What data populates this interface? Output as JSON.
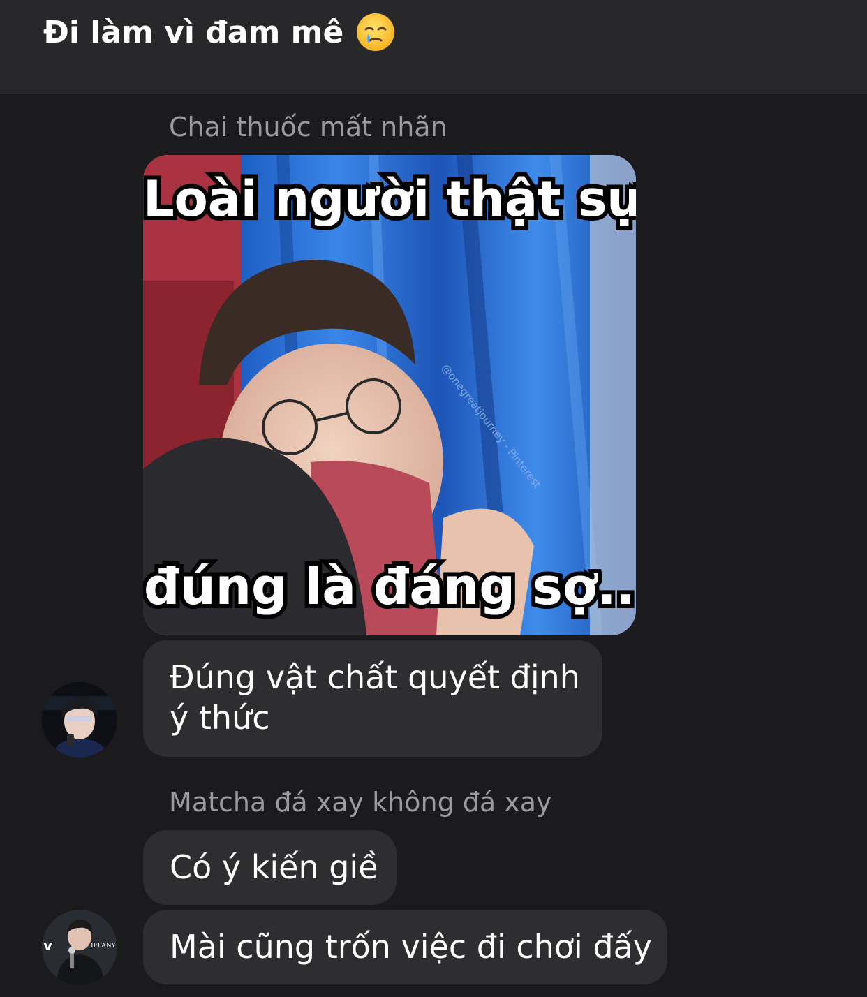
{
  "header": {
    "title": "Đi làm vì đam mê",
    "emoji": "face-holding-back-tears-icon"
  },
  "messages": [
    {
      "sender": "Chai thuốc mất nhãn",
      "image": {
        "caption_top": "Loài người thật sự",
        "caption_bottom": "đúng là đáng sợ..",
        "watermark": "@onegreatjourney - Pinterest"
      },
      "text_lines": [
        "Đúng vật chất quyết định",
        "ý thức"
      ]
    },
    {
      "sender": "Matcha đá xay không đá xay",
      "texts": [
        "Có ý kiến giề",
        "Mài cũng trốn việc đi chơi đấy"
      ],
      "avatar_text": "IFFANY"
    }
  ],
  "colors": {
    "background": "#1b1b1d",
    "header": "#28282a",
    "bubble": "#2e2e31",
    "sender_name": "#9a9a9f"
  }
}
